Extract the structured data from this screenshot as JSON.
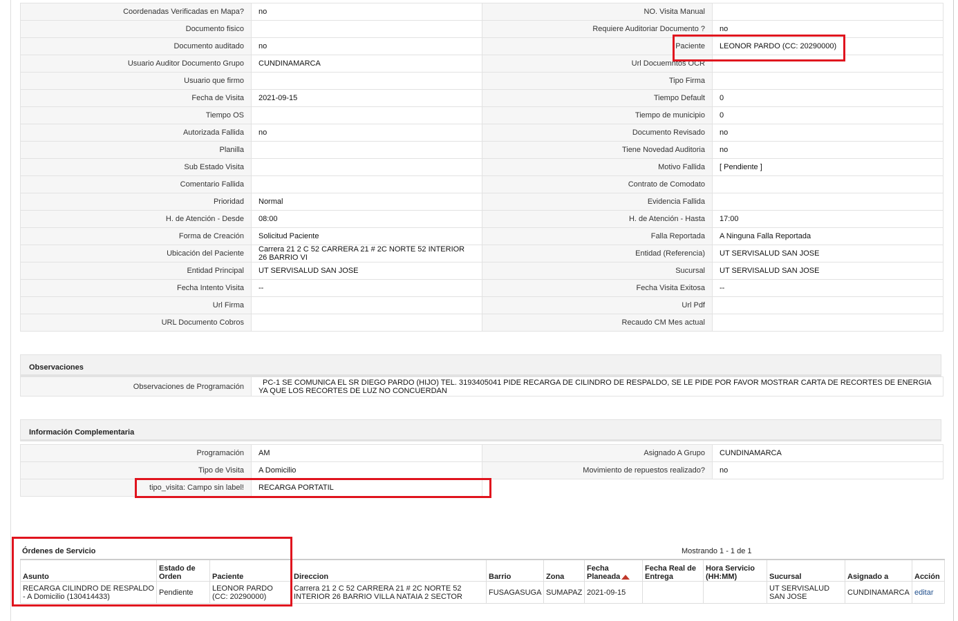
{
  "detail_rows": [
    {
      "l1": "Coordenadas Verificadas en Mapa?",
      "v1": "no",
      "l2": "NO. Visita Manual",
      "v2": ""
    },
    {
      "l1": "Documento fisico",
      "v1": "",
      "l2": "Requiere Auditoriar Documento ?",
      "v2": "no"
    },
    {
      "l1": "Documento auditado",
      "v1": "no",
      "l2": "Paciente",
      "v2": "LEONOR PARDO (CC: 20290000)"
    },
    {
      "l1": "Usuario Auditor Documento Grupo",
      "v1": "CUNDINAMARCA",
      "l2": "Url Docuemntos OCR",
      "v2": ""
    },
    {
      "l1": "Usuario que firmo",
      "v1": "",
      "l2": "Tipo Firma",
      "v2": ""
    },
    {
      "l1": "Fecha de Visita",
      "v1": "2021-09-15",
      "l2": "Tiempo Default",
      "v2": "0"
    },
    {
      "l1": "Tiempo OS",
      "v1": "",
      "l2": "Tiempo de municipio",
      "v2": "0"
    },
    {
      "l1": "Autorizada Fallida",
      "v1": "no",
      "l2": "Documento Revisado",
      "v2": "no"
    },
    {
      "l1": "Planilla",
      "v1": "",
      "l2": "Tiene Novedad Auditoria",
      "v2": "no"
    },
    {
      "l1": "Sub Estado Visita",
      "v1": "",
      "l2": "Motivo Fallida",
      "v2": "[ Pendiente ]"
    },
    {
      "l1": "Comentario Fallida",
      "v1": "",
      "l2": "Contrato de Comodato",
      "v2": ""
    },
    {
      "l1": "Prioridad",
      "v1": "Normal",
      "l2": "Evidencia Fallida",
      "v2": ""
    },
    {
      "l1": "H. de Atención - Desde",
      "v1": "08:00",
      "l2": "H. de Atención - Hasta",
      "v2": "17:00"
    },
    {
      "l1": "Forma de Creación",
      "v1": "Solicitud Paciente",
      "l2": "Falla Reportada",
      "v2": "A Ninguna Falla Reportada"
    },
    {
      "l1": "Ubicación del Paciente",
      "v1": "Carrera 21 2 C 52 CARRERA 21 # 2C NORTE 52 INTERIOR 26 BARRIO VI",
      "l2": "Entidad (Referencia)",
      "v2": "UT SERVISALUD SAN JOSE"
    },
    {
      "l1": "Entidad Principal",
      "v1": "UT SERVISALUD SAN JOSE",
      "l2": "Sucursal",
      "v2": "UT SERVISALUD SAN JOSE"
    },
    {
      "l1": "Fecha Intento Visita",
      "v1": "--",
      "l2": "Fecha Visita Exitosa",
      "v2": "--"
    },
    {
      "l1": "Url Firma",
      "v1": "",
      "l2": "Url Pdf",
      "v2": ""
    },
    {
      "l1": "URL Documento Cobros",
      "v1": "",
      "l2": "Recaudo CM Mes actual",
      "v2": ""
    }
  ],
  "observaciones": {
    "title": "Observaciones",
    "label": "Observaciones de Programación",
    "value": "PC-1 SE COMUNICA EL SR DIEGO PARDO (HIJO) TEL. 3193405041 PIDE RECARGA DE CILINDRO DE RESPALDO, SE LE PIDE POR FAVOR MOSTRAR CARTA DE RECORTES DE ENERGIA YA QUE LOS RECORTES DE LUZ NO CONCUERDAN"
  },
  "complementaria": {
    "title": "Información Complementaria",
    "rows": [
      {
        "l1": "Programación",
        "v1": "AM",
        "l2": "Asignado A Grupo",
        "v2": "CUNDINAMARCA"
      },
      {
        "l1": "Tipo de Visita",
        "v1": "A Domicilio",
        "l2": "Movimiento de repuestos realizado?",
        "v2": "no"
      }
    ],
    "tipo_label": "tipo_visita: Campo sin label!",
    "tipo_value": "RECARGA PORTATIL"
  },
  "ordenes": {
    "title": "Órdenes de Servicio",
    "showing": "Mostrando 1 - 1 de 1",
    "headers": {
      "asunto": "Asunto",
      "estado": "Estado de Orden",
      "paciente": "Paciente",
      "direccion": "Direccion",
      "barrio": "Barrio",
      "zona": "Zona",
      "fecha_planeada": "Fecha Planeada",
      "fecha_real": "Fecha Real de Entrega",
      "hora": "Hora Servicio (HH:MM)",
      "sucursal": "Sucursal",
      "asignado": "Asignado a",
      "accion": "Acción"
    },
    "row": {
      "asunto": "RECARGA CILINDRO DE RESPALDO - A Domicilio (130414433)",
      "estado": "Pendiente",
      "paciente": "LEONOR PARDO (CC: 20290000)",
      "direccion": "Carrera 21 2 C 52 CARRERA 21 # 2C NORTE 52 INTERIOR 26 BARRIO VILLA NATAIA 2 SECTOR",
      "barrio": "FUSAGASUGA",
      "zona": "SUMAPAZ",
      "fecha_planeada": "2021-09-15",
      "fecha_real": "",
      "hora": "",
      "sucursal": "UT SERVISALUD SAN JOSE",
      "asignado": "CUNDINAMARCA",
      "accion": "editar"
    }
  },
  "colors": {
    "highlight": "#e0141e",
    "label_bg": "#f6f6f6",
    "section_bg": "#f2f2f2"
  }
}
